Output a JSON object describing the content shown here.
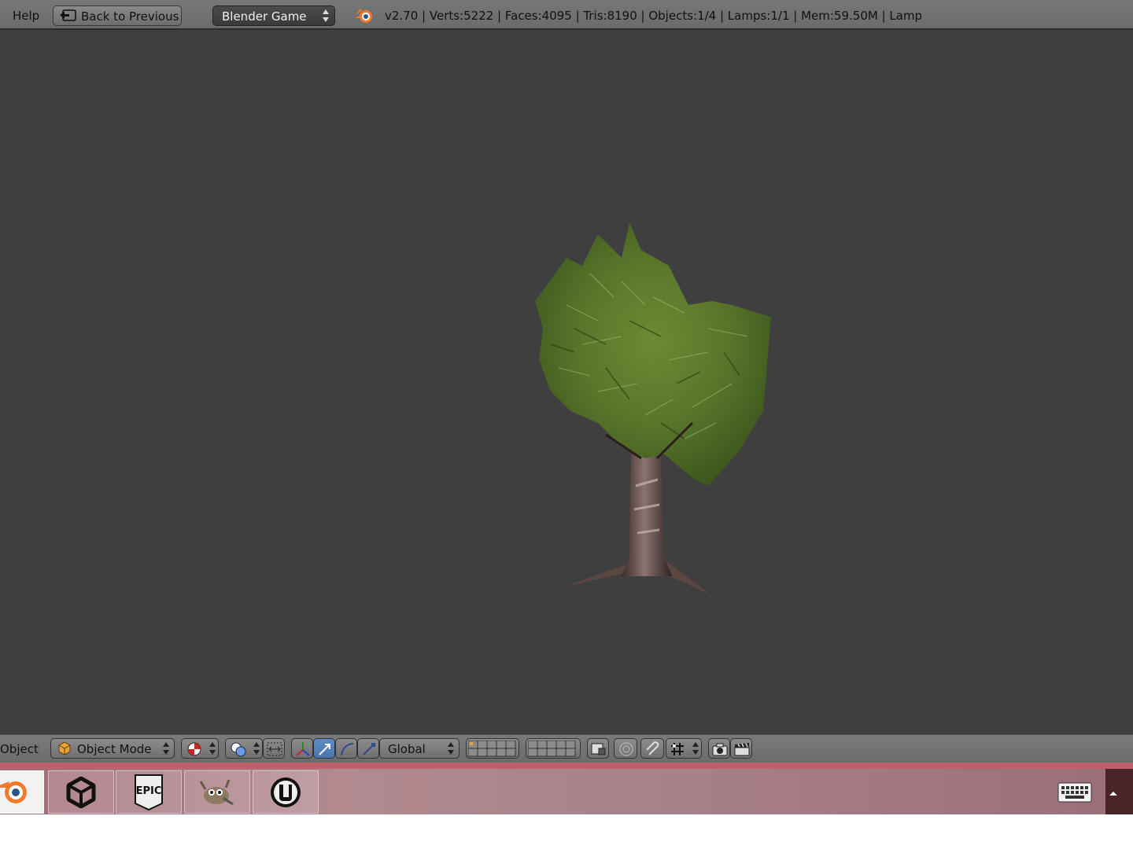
{
  "topbar": {
    "help_label": "Help",
    "back_label": "Back to Previous",
    "engine_selected": "Blender Game",
    "stats": "v2.70 | Verts:5222 | Faces:4095 | Tris:8190 | Objects:1/4 | Lamps:1/1 | Mem:59.50M | Lamp"
  },
  "viewport": {
    "background": "#3f3f3f",
    "object": "tree-model"
  },
  "viewheader": {
    "menu_label": "Object",
    "mode_selected": "Object Mode",
    "orientation_selected": "Global",
    "selected_color": "#5d8cc4"
  },
  "taskbar": {
    "apps": [
      "blender-icon",
      "unity-icon",
      "epic-games-icon",
      "gimp-icon",
      "unreal-engine-icon"
    ],
    "epic_logo_text": "EPIC",
    "accent": "#c0606c",
    "tray": [
      "keyboard-icon",
      "show-hidden-icons-arrow"
    ]
  }
}
